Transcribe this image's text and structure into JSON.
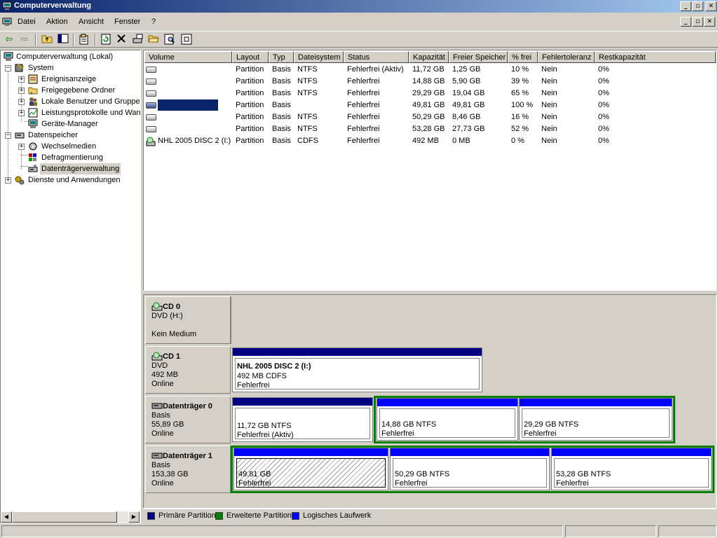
{
  "window": {
    "title": "Computerverwaltung",
    "controls": [
      "_",
      "▫",
      "✕"
    ]
  },
  "menu": [
    "Datei",
    "Aktion",
    "Ansicht",
    "Fenster",
    "?"
  ],
  "tree": {
    "root": "Computerverwaltung (Lokal)",
    "items": [
      "System",
      "Ereignisanzeige",
      "Freigegebene Ordner",
      "Lokale Benutzer und Gruppen",
      "Leistungsprotokolle und Warnungen",
      "Geräte-Manager",
      "Datenspeicher",
      "Wechselmedien",
      "Defragmentierung",
      "Datenträgerverwaltung",
      "Dienste und Anwendungen"
    ]
  },
  "volumes": {
    "columns": [
      "Volume",
      "Layout",
      "Typ",
      "Dateisystem",
      "Status",
      "Kapazität",
      "Freier Speicher",
      "% frei",
      "Fehlertoleranz",
      "Restkapazität"
    ],
    "rows": [
      {
        "volume": "",
        "layout": "Partition",
        "typ": "Basis",
        "fs": "NTFS",
        "status": "Fehlerfrei (Aktiv)",
        "cap": "11,72 GB",
        "free": "1,25 GB",
        "pct": "10 %",
        "ft": "Nein",
        "rest": "0%"
      },
      {
        "volume": "",
        "layout": "Partition",
        "typ": "Basis",
        "fs": "NTFS",
        "status": "Fehlerfrei",
        "cap": "14,88 GB",
        "free": "5,90 GB",
        "pct": "39 %",
        "ft": "Nein",
        "rest": "0%"
      },
      {
        "volume": "",
        "layout": "Partition",
        "typ": "Basis",
        "fs": "NTFS",
        "status": "Fehlerfrei",
        "cap": "29,29 GB",
        "free": "19,04 GB",
        "pct": "65 %",
        "ft": "Nein",
        "rest": "0%"
      },
      {
        "volume": "",
        "layout": "Partition",
        "typ": "Basis",
        "fs": "",
        "status": "Fehlerfrei",
        "cap": "49,81 GB",
        "free": "49,81 GB",
        "pct": "100 %",
        "ft": "Nein",
        "rest": "0%"
      },
      {
        "volume": "",
        "layout": "Partition",
        "typ": "Basis",
        "fs": "NTFS",
        "status": "Fehlerfrei",
        "cap": "50,29 GB",
        "free": "8,46 GB",
        "pct": "16 %",
        "ft": "Nein",
        "rest": "0%"
      },
      {
        "volume": "",
        "layout": "Partition",
        "typ": "Basis",
        "fs": "NTFS",
        "status": "Fehlerfrei",
        "cap": "53,28 GB",
        "free": "27,73 GB",
        "pct": "52 %",
        "ft": "Nein",
        "rest": "0%"
      },
      {
        "volume": "NHL 2005 DISC 2 (I:)",
        "layout": "Partition",
        "typ": "Basis",
        "fs": "CDFS",
        "status": "Fehlerfrei",
        "cap": "492 MB",
        "free": "0 MB",
        "pct": "0 %",
        "ft": "Nein",
        "rest": "0%"
      }
    ]
  },
  "disks": [
    {
      "name": "CD 0",
      "lines": [
        "DVD (H:)",
        "",
        "Kein Medium"
      ],
      "parts": []
    },
    {
      "name": "CD 1",
      "lines": [
        "DVD",
        "492 MB",
        "Online"
      ],
      "parts": [
        {
          "title": "NHL 2005 DISC 2  (I:)",
          "l1": "492 MB CDFS",
          "l2": "Fehlerfrei"
        }
      ]
    },
    {
      "name": "Datenträger 0",
      "lines": [
        "Basis",
        "55,89 GB",
        "Online"
      ],
      "parts": [
        {
          "l1": "11,72 GB NTFS",
          "l2": "Fehlerfrei (Aktiv)"
        },
        {
          "l1": "14,88 GB NTFS",
          "l2": "Fehlerfrei"
        },
        {
          "l1": "29,29 GB NTFS",
          "l2": "Fehlerfrei"
        }
      ]
    },
    {
      "name": "Datenträger 1",
      "lines": [
        "Basis",
        "153,38 GB",
        "Online"
      ],
      "parts": [
        {
          "l1": "49,81 GB",
          "l2": "Fehlerfrei"
        },
        {
          "l1": "50,29 GB NTFS",
          "l2": "Fehlerfrei"
        },
        {
          "l1": "53,28 GB NTFS",
          "l2": "Fehlerfrei"
        }
      ]
    }
  ],
  "legend": [
    {
      "label": "Primäre Partition",
      "color": "#000080"
    },
    {
      "label": "Erweiterte Partition",
      "color": "#008000"
    },
    {
      "label": "Logisches Laufwerk",
      "color": "#0000ff"
    }
  ]
}
